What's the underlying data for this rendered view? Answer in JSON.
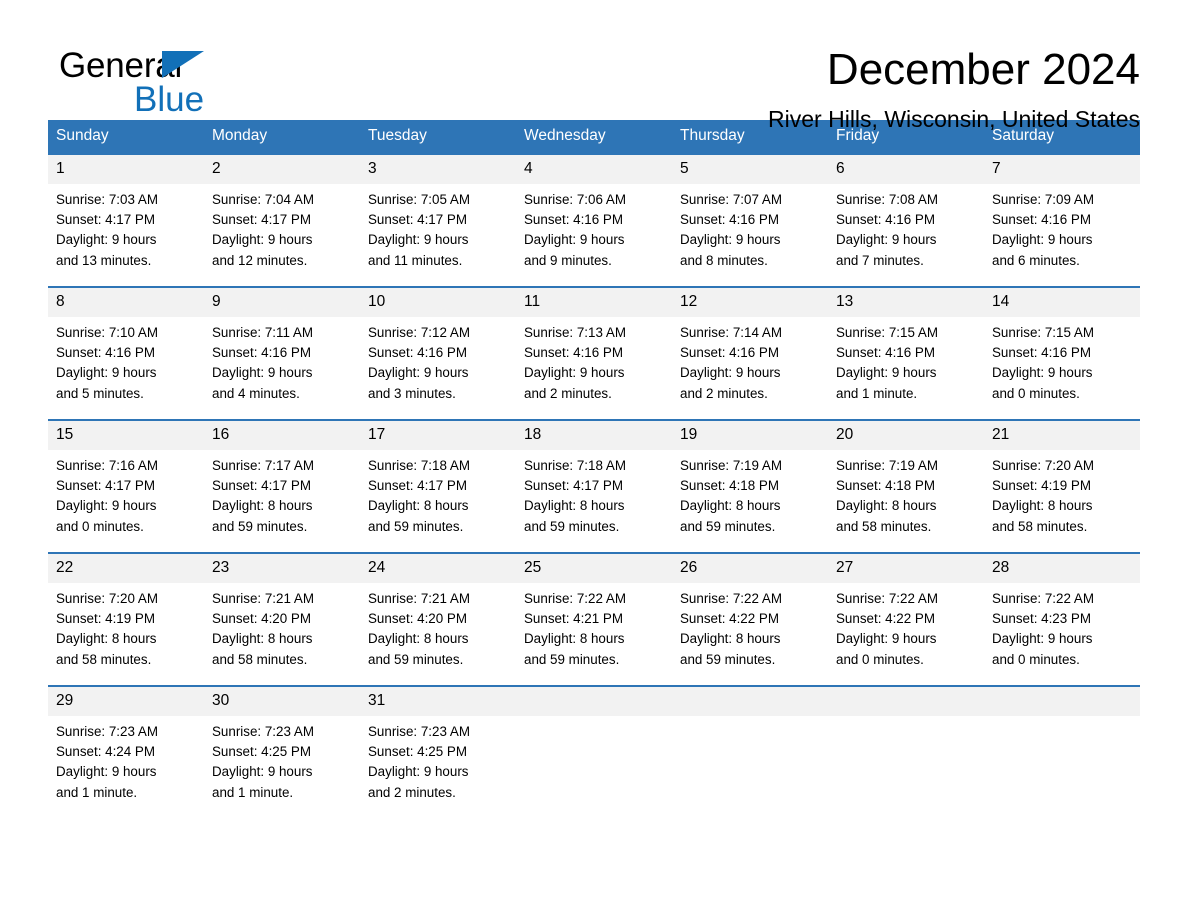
{
  "brand": {
    "name_line1": "General",
    "name_line2": "Blue",
    "accent_color": "#1270b8"
  },
  "header": {
    "month_title": "December 2024",
    "location": "River Hills, Wisconsin, United States"
  },
  "calendar": {
    "header_bg": "#2e75b6",
    "daynum_bg": "#f2f2f2",
    "weekday_headers": [
      "Sunday",
      "Monday",
      "Tuesday",
      "Wednesday",
      "Thursday",
      "Friday",
      "Saturday"
    ],
    "weeks": [
      [
        {
          "day": "1",
          "sunrise": "Sunrise: 7:03 AM",
          "sunset": "Sunset: 4:17 PM",
          "daylight_line1": "Daylight: 9 hours",
          "daylight_line2": "and 13 minutes."
        },
        {
          "day": "2",
          "sunrise": "Sunrise: 7:04 AM",
          "sunset": "Sunset: 4:17 PM",
          "daylight_line1": "Daylight: 9 hours",
          "daylight_line2": "and 12 minutes."
        },
        {
          "day": "3",
          "sunrise": "Sunrise: 7:05 AM",
          "sunset": "Sunset: 4:17 PM",
          "daylight_line1": "Daylight: 9 hours",
          "daylight_line2": "and 11 minutes."
        },
        {
          "day": "4",
          "sunrise": "Sunrise: 7:06 AM",
          "sunset": "Sunset: 4:16 PM",
          "daylight_line1": "Daylight: 9 hours",
          "daylight_line2": "and 9 minutes."
        },
        {
          "day": "5",
          "sunrise": "Sunrise: 7:07 AM",
          "sunset": "Sunset: 4:16 PM",
          "daylight_line1": "Daylight: 9 hours",
          "daylight_line2": "and 8 minutes."
        },
        {
          "day": "6",
          "sunrise": "Sunrise: 7:08 AM",
          "sunset": "Sunset: 4:16 PM",
          "daylight_line1": "Daylight: 9 hours",
          "daylight_line2": "and 7 minutes."
        },
        {
          "day": "7",
          "sunrise": "Sunrise: 7:09 AM",
          "sunset": "Sunset: 4:16 PM",
          "daylight_line1": "Daylight: 9 hours",
          "daylight_line2": "and 6 minutes."
        }
      ],
      [
        {
          "day": "8",
          "sunrise": "Sunrise: 7:10 AM",
          "sunset": "Sunset: 4:16 PM",
          "daylight_line1": "Daylight: 9 hours",
          "daylight_line2": "and 5 minutes."
        },
        {
          "day": "9",
          "sunrise": "Sunrise: 7:11 AM",
          "sunset": "Sunset: 4:16 PM",
          "daylight_line1": "Daylight: 9 hours",
          "daylight_line2": "and 4 minutes."
        },
        {
          "day": "10",
          "sunrise": "Sunrise: 7:12 AM",
          "sunset": "Sunset: 4:16 PM",
          "daylight_line1": "Daylight: 9 hours",
          "daylight_line2": "and 3 minutes."
        },
        {
          "day": "11",
          "sunrise": "Sunrise: 7:13 AM",
          "sunset": "Sunset: 4:16 PM",
          "daylight_line1": "Daylight: 9 hours",
          "daylight_line2": "and 2 minutes."
        },
        {
          "day": "12",
          "sunrise": "Sunrise: 7:14 AM",
          "sunset": "Sunset: 4:16 PM",
          "daylight_line1": "Daylight: 9 hours",
          "daylight_line2": "and 2 minutes."
        },
        {
          "day": "13",
          "sunrise": "Sunrise: 7:15 AM",
          "sunset": "Sunset: 4:16 PM",
          "daylight_line1": "Daylight: 9 hours",
          "daylight_line2": "and 1 minute."
        },
        {
          "day": "14",
          "sunrise": "Sunrise: 7:15 AM",
          "sunset": "Sunset: 4:16 PM",
          "daylight_line1": "Daylight: 9 hours",
          "daylight_line2": "and 0 minutes."
        }
      ],
      [
        {
          "day": "15",
          "sunrise": "Sunrise: 7:16 AM",
          "sunset": "Sunset: 4:17 PM",
          "daylight_line1": "Daylight: 9 hours",
          "daylight_line2": "and 0 minutes."
        },
        {
          "day": "16",
          "sunrise": "Sunrise: 7:17 AM",
          "sunset": "Sunset: 4:17 PM",
          "daylight_line1": "Daylight: 8 hours",
          "daylight_line2": "and 59 minutes."
        },
        {
          "day": "17",
          "sunrise": "Sunrise: 7:18 AM",
          "sunset": "Sunset: 4:17 PM",
          "daylight_line1": "Daylight: 8 hours",
          "daylight_line2": "and 59 minutes."
        },
        {
          "day": "18",
          "sunrise": "Sunrise: 7:18 AM",
          "sunset": "Sunset: 4:17 PM",
          "daylight_line1": "Daylight: 8 hours",
          "daylight_line2": "and 59 minutes."
        },
        {
          "day": "19",
          "sunrise": "Sunrise: 7:19 AM",
          "sunset": "Sunset: 4:18 PM",
          "daylight_line1": "Daylight: 8 hours",
          "daylight_line2": "and 59 minutes."
        },
        {
          "day": "20",
          "sunrise": "Sunrise: 7:19 AM",
          "sunset": "Sunset: 4:18 PM",
          "daylight_line1": "Daylight: 8 hours",
          "daylight_line2": "and 58 minutes."
        },
        {
          "day": "21",
          "sunrise": "Sunrise: 7:20 AM",
          "sunset": "Sunset: 4:19 PM",
          "daylight_line1": "Daylight: 8 hours",
          "daylight_line2": "and 58 minutes."
        }
      ],
      [
        {
          "day": "22",
          "sunrise": "Sunrise: 7:20 AM",
          "sunset": "Sunset: 4:19 PM",
          "daylight_line1": "Daylight: 8 hours",
          "daylight_line2": "and 58 minutes."
        },
        {
          "day": "23",
          "sunrise": "Sunrise: 7:21 AM",
          "sunset": "Sunset: 4:20 PM",
          "daylight_line1": "Daylight: 8 hours",
          "daylight_line2": "and 58 minutes."
        },
        {
          "day": "24",
          "sunrise": "Sunrise: 7:21 AM",
          "sunset": "Sunset: 4:20 PM",
          "daylight_line1": "Daylight: 8 hours",
          "daylight_line2": "and 59 minutes."
        },
        {
          "day": "25",
          "sunrise": "Sunrise: 7:22 AM",
          "sunset": "Sunset: 4:21 PM",
          "daylight_line1": "Daylight: 8 hours",
          "daylight_line2": "and 59 minutes."
        },
        {
          "day": "26",
          "sunrise": "Sunrise: 7:22 AM",
          "sunset": "Sunset: 4:22 PM",
          "daylight_line1": "Daylight: 8 hours",
          "daylight_line2": "and 59 minutes."
        },
        {
          "day": "27",
          "sunrise": "Sunrise: 7:22 AM",
          "sunset": "Sunset: 4:22 PM",
          "daylight_line1": "Daylight: 9 hours",
          "daylight_line2": "and 0 minutes."
        },
        {
          "day": "28",
          "sunrise": "Sunrise: 7:22 AM",
          "sunset": "Sunset: 4:23 PM",
          "daylight_line1": "Daylight: 9 hours",
          "daylight_line2": "and 0 minutes."
        }
      ],
      [
        {
          "day": "29",
          "sunrise": "Sunrise: 7:23 AM",
          "sunset": "Sunset: 4:24 PM",
          "daylight_line1": "Daylight: 9 hours",
          "daylight_line2": "and 1 minute."
        },
        {
          "day": "30",
          "sunrise": "Sunrise: 7:23 AM",
          "sunset": "Sunset: 4:25 PM",
          "daylight_line1": "Daylight: 9 hours",
          "daylight_line2": "and 1 minute."
        },
        {
          "day": "31",
          "sunrise": "Sunrise: 7:23 AM",
          "sunset": "Sunset: 4:25 PM",
          "daylight_line1": "Daylight: 9 hours",
          "daylight_line2": "and 2 minutes."
        },
        {
          "day": "",
          "sunrise": "",
          "sunset": "",
          "daylight_line1": "",
          "daylight_line2": ""
        },
        {
          "day": "",
          "sunrise": "",
          "sunset": "",
          "daylight_line1": "",
          "daylight_line2": ""
        },
        {
          "day": "",
          "sunrise": "",
          "sunset": "",
          "daylight_line1": "",
          "daylight_line2": ""
        },
        {
          "day": "",
          "sunrise": "",
          "sunset": "",
          "daylight_line1": "",
          "daylight_line2": ""
        }
      ]
    ]
  }
}
